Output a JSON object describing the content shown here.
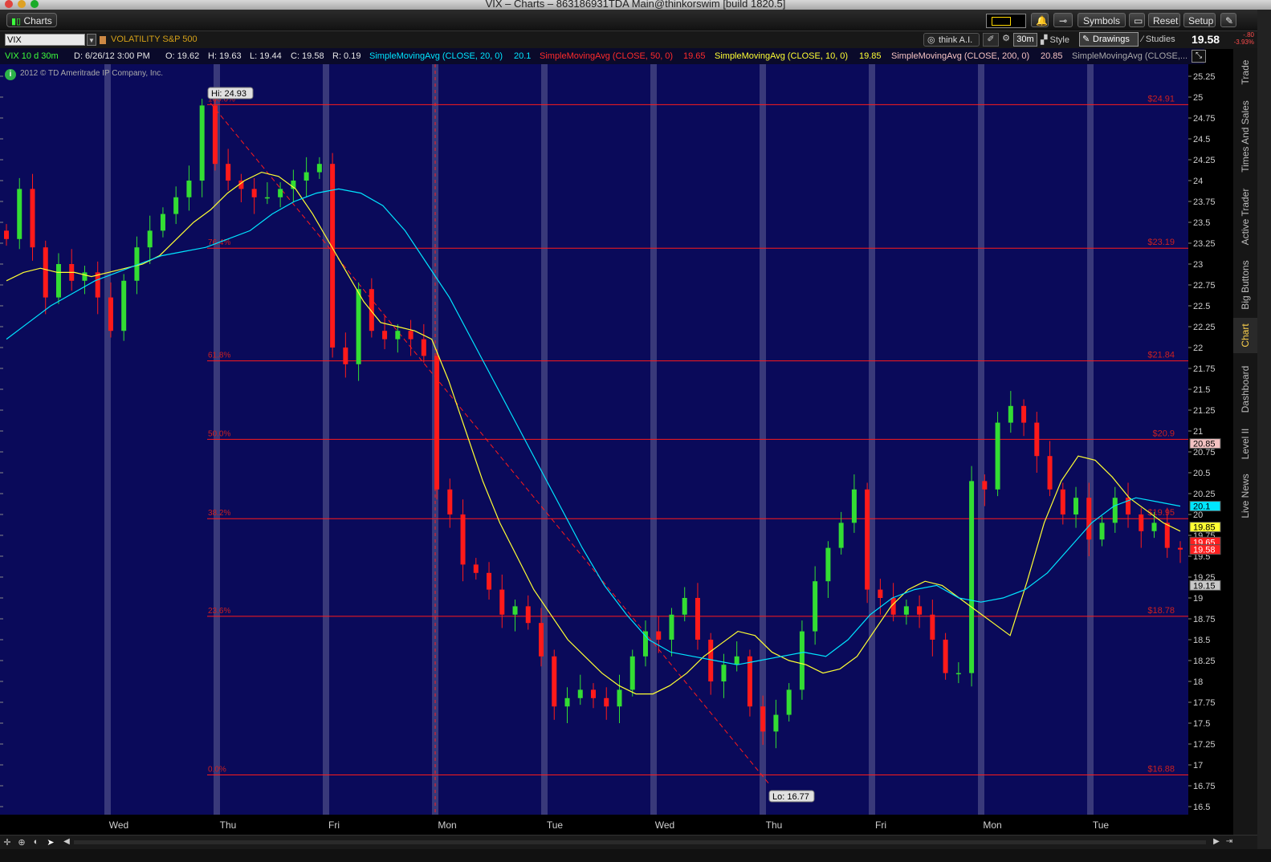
{
  "window": {
    "title": "VIX – Charts – 863186931TDA Main@thinkorswim [build 1820.5]"
  },
  "toolbar": {
    "tab_label": "Charts",
    "symbols_label": "Symbols",
    "reset_label": "Reset",
    "setup_label": "Setup"
  },
  "row2": {
    "symbol": "VIX",
    "description": "VOLATILITY S&P 500",
    "think_ai": "think A.I.",
    "timeframe": "30m",
    "style": "Style",
    "drawings": "Drawings",
    "studies": "Studies",
    "last_price": "19.58",
    "change": "-.80",
    "change_pct": "-3.93%"
  },
  "info": {
    "symbol_period": "VIX 10 d 30m",
    "date": "D: 6/26/12 3:00 PM",
    "open": "O: 19.62",
    "high": "H: 19.63",
    "low": "L: 19.44",
    "close": "C: 19.58",
    "range": "R: 0.19",
    "sma20_label": "SimpleMovingAvg (CLOSE, 20, 0)",
    "sma20_val": "20.1",
    "sma50_label": "SimpleMovingAvg (CLOSE, 50, 0)",
    "sma50_val": "19.65",
    "sma10_label": "SimpleMovingAvg (CLOSE, 10, 0)",
    "sma10_val": "19.85",
    "sma200_label": "SimpleMovingAvg (CLOSE, 200, 0)",
    "sma200_val": "20.85",
    "sma_extra_label": "SimpleMovingAvg (CLOSE,..."
  },
  "copyright": "2012 © TD Ameritrade IP Company, Inc.",
  "chart_data": {
    "type": "candlestick",
    "ylim": [
      16.5,
      25.25
    ],
    "yticks": [
      "25.25",
      "25",
      "24.75",
      "24.5",
      "24.25",
      "24",
      "23.75",
      "23.5",
      "23.25",
      "23",
      "22.75",
      "22.5",
      "22.25",
      "22",
      "21.75",
      "21.5",
      "21.25",
      "21",
      "20.75",
      "20.5",
      "20.25",
      "20",
      "19.75",
      "19.5",
      "19.25",
      "19",
      "18.75",
      "18.5",
      "18.25",
      "18",
      "17.75",
      "17.5",
      "17.25",
      "17",
      "16.75",
      "16.5"
    ],
    "xlabels": [
      "Wed",
      "Thu",
      "Fri",
      "Mon",
      "Tue",
      "Wed",
      "Thu",
      "Fri",
      "Mon",
      "Tue"
    ],
    "high_label": "Hi: 24.93",
    "low_label": "Lo: 16.77",
    "fib_levels": [
      {
        "pct": "100.0%",
        "value": "$24.91",
        "price": 24.91
      },
      {
        "pct": "76.4%",
        "value": "$23.19",
        "price": 23.19
      },
      {
        "pct": "61.8%",
        "value": "$21.84",
        "price": 21.84
      },
      {
        "pct": "50.0%",
        "value": "$20.9",
        "price": 20.9
      },
      {
        "pct": "38.2%",
        "value": "$19.95",
        "price": 19.95
      },
      {
        "pct": "23.6%",
        "value": "$18.78",
        "price": 18.78
      },
      {
        "pct": "0.0%",
        "value": "$16.88",
        "price": 16.88
      }
    ],
    "price_tags": [
      {
        "label": "20.85",
        "price": 20.85,
        "color": "#f4c2c2",
        "text": "#000"
      },
      {
        "label": "20.1",
        "price": 20.1,
        "color": "#00e5ff",
        "text": "#000"
      },
      {
        "label": "19.85",
        "price": 19.85,
        "color": "#ffff33",
        "text": "#000"
      },
      {
        "label": "19.65",
        "price": 19.67,
        "color": "#ff2020",
        "text": "#fff"
      },
      {
        "label": "19.58",
        "price": 19.58,
        "color": "#ff2020",
        "text": "#fff"
      },
      {
        "label": "19.15",
        "price": 19.15,
        "color": "#c8c8c8",
        "text": "#000"
      }
    ],
    "closes": [
      23.3,
      23.9,
      23.2,
      22.6,
      23.0,
      22.8,
      22.9,
      22.6,
      22.2,
      22.8,
      23.2,
      23.4,
      23.6,
      23.8,
      24.0,
      24.9,
      24.2,
      24.0,
      23.9,
      23.8,
      23.8,
      23.9,
      24.0,
      24.1,
      24.2,
      22.0,
      21.8,
      22.7,
      22.2,
      22.1,
      22.2,
      22.1,
      21.9,
      20.3,
      20.0,
      19.4,
      19.3,
      19.1,
      18.8,
      18.9,
      18.7,
      18.3,
      17.7,
      17.8,
      17.9,
      17.8,
      17.7,
      17.9,
      18.3,
      18.6,
      18.5,
      18.8,
      19.0,
      18.5,
      18.0,
      18.2,
      18.3,
      17.7,
      17.4,
      17.6,
      17.9,
      18.6,
      19.2,
      19.6,
      19.9,
      20.3,
      19.1,
      19.0,
      18.8,
      18.9,
      18.8,
      18.5,
      18.1,
      18.1,
      20.4,
      20.3,
      21.1,
      21.3,
      21.1,
      20.7,
      20.3,
      20.0,
      20.2,
      19.7,
      19.9,
      20.2,
      20.0,
      19.8,
      19.9,
      19.6,
      19.58
    ],
    "sma10": [
      22.8,
      22.9,
      22.95,
      22.9,
      22.9,
      22.85,
      22.9,
      22.95,
      23.0,
      23.1,
      23.3,
      23.5,
      23.65,
      23.85,
      24.0,
      24.1,
      24.05,
      23.9,
      23.6,
      23.25,
      22.9,
      22.55,
      22.3,
      22.25,
      22.2,
      22.1,
      21.6,
      21.0,
      20.4,
      19.9,
      19.5,
      19.1,
      18.8,
      18.5,
      18.3,
      18.1,
      17.95,
      17.85,
      17.85,
      17.95,
      18.1,
      18.3,
      18.45,
      18.6,
      18.55,
      18.35,
      18.25,
      18.2,
      18.1,
      18.15,
      18.3,
      18.6,
      18.9,
      19.1,
      19.2,
      19.15,
      19.0,
      18.85,
      18.7,
      18.55,
      19.2,
      19.9,
      20.4,
      20.7,
      20.65,
      20.45,
      20.2,
      20.05,
      19.9,
      19.8
    ],
    "sma20": [
      22.1,
      22.3,
      22.5,
      22.65,
      22.8,
      22.9,
      23.0,
      23.1,
      23.15,
      23.2,
      23.3,
      23.4,
      23.6,
      23.75,
      23.85,
      23.9,
      23.85,
      23.7,
      23.4,
      23.0,
      22.6,
      22.1,
      21.6,
      21.1,
      20.6,
      20.1,
      19.6,
      19.15,
      18.8,
      18.5,
      18.35,
      18.3,
      18.25,
      18.2,
      18.25,
      18.3,
      18.35,
      18.3,
      18.5,
      18.8,
      19.0,
      19.1,
      19.15,
      19.0,
      18.95,
      19.0,
      19.1,
      19.3,
      19.6,
      19.9,
      20.1,
      20.2,
      20.15,
      20.1
    ]
  },
  "sidetabs": [
    "Trade",
    "Times And Sales",
    "Active Trader",
    "Big Buttons",
    "Chart",
    "Dashboard",
    "Level II",
    "Live News"
  ]
}
